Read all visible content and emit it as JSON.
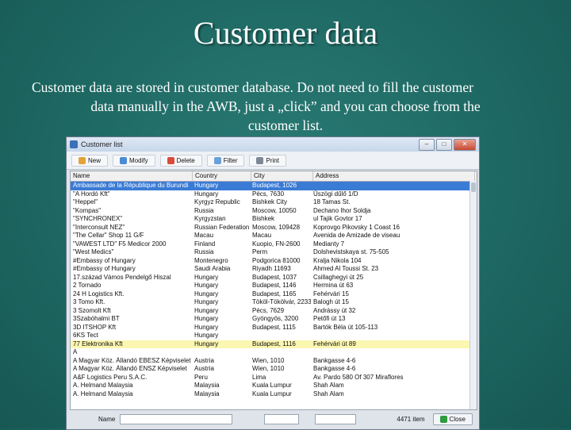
{
  "slide": {
    "title": "Customer data",
    "body_line1": "Customer data are stored in customer database. Do not need to fill the customer",
    "body_line2": "data manually in the AWB, just a „click” and you can choose from the",
    "body_line3": "customer list."
  },
  "window": {
    "title": "Customer list",
    "toolbar": {
      "new": "New",
      "modify": "Modify",
      "delete": "Delete",
      "filter": "Filter",
      "print": "Print"
    },
    "columns": [
      "Name",
      "Country",
      "City",
      "Address"
    ],
    "rows": [
      [
        "Ambassade de la République du Burundi",
        "Hungary",
        "Budapest, 1026",
        ""
      ],
      [
        "\"A Hordó Kft\"",
        "Hungary",
        "Pécs, 7630",
        "Üszögi dűlő 1/D"
      ],
      [
        "\"Heppel\"",
        "Kyrgyz Republic",
        "Bishkek City",
        "18 Tamas St."
      ],
      [
        "\"Kompas\"",
        "Russia",
        "Moscow, 10050",
        "Dechano Ihor Soldja"
      ],
      [
        "\"SYNCHRONEX\"",
        "Kyrgyzstan",
        "Bishkek",
        "ul Tajik Govtor 17"
      ],
      [
        "\"Interconsult NEZ\"",
        "Russian Federation",
        "Moscow, 109428",
        "Koprovgo Pikovsky 1 Coast 16"
      ],
      [
        "\"The Cellar\" Shop 11 G/F",
        "Macau",
        "Macau",
        "Avenida de Amizade de viseau"
      ],
      [
        "\"VAWEST LTD\" F5 Medicor 2000",
        "Finland",
        "Kuopio, FN-2600",
        "Medianty 7"
      ],
      [
        "\"West Medics\"",
        "Russia",
        "Perm",
        "Dolshevistskaya st. 75-505"
      ],
      [
        "#Embassy of Hungary",
        "Montenegro",
        "Podgorica 81000",
        "Kralja Nikola 104"
      ],
      [
        "#Embassy of Hungary",
        "Saudi Arabia",
        "Riyadh 11693",
        "Ahmed Al Toussi St. 23"
      ],
      [
        "17.század Vámos Pendelgő Hiszal",
        "Hungary",
        "Budapest, 1037",
        "Csillaghegyi út 25"
      ],
      [
        "2 Tornado",
        "Hungary",
        "Budapest, 1146",
        "Hermina út 63"
      ],
      [
        "24 H Logistics Kft.",
        "Hungary",
        "Budapest, 1165",
        "Fehérvári 15"
      ],
      [
        "3 Tomo Kft.",
        "Hungary",
        "Tököl-Tökölvár, 2233",
        "Balogh út 15"
      ],
      [
        "3 Szomolt Kft",
        "Hungary",
        "Pécs, 7629",
        "Andrássy út 32"
      ],
      [
        "3Szabóhalmi BT",
        "Hungary",
        "Gyöngyös, 3200",
        "Petőfi út 13"
      ],
      [
        "3D ITSHOP Kft",
        "Hungary",
        "Budapest, 1115",
        "Bartók Béla út 105-113"
      ],
      [
        "6KS Tect",
        "Hungary",
        "",
        ""
      ],
      [
        "77 Elektronika Kft",
        "Hungary",
        "Budapest, 1116",
        "Fehérvári út 89"
      ],
      [
        "A",
        "",
        "",
        ""
      ],
      [
        "A Magyar Köz. Állandó EBESZ Képviselet",
        "Austria",
        "Wien, 1010",
        "Bankgasse 4-6"
      ],
      [
        "A Magyar Köz. Állandó ENSZ Képviselet",
        "Austria",
        "Wien, 1010",
        "Bankgasse 4-6"
      ],
      [
        "A&F Logistics Peru S.A.C.",
        "Peru",
        "Lima",
        "Av. Pardo 580 Of 307 Miraflores"
      ],
      [
        "A. Helmand Malaysia",
        "Malaysia",
        "Kuala Lumpur",
        "Shah Alam"
      ],
      [
        "A. Helmand Malaysia",
        "Malaysia",
        "Kuala Lumpur",
        "Shah Alam"
      ]
    ],
    "bottom": {
      "name_label": "Name",
      "count": "4471 item",
      "close": "Close"
    }
  }
}
